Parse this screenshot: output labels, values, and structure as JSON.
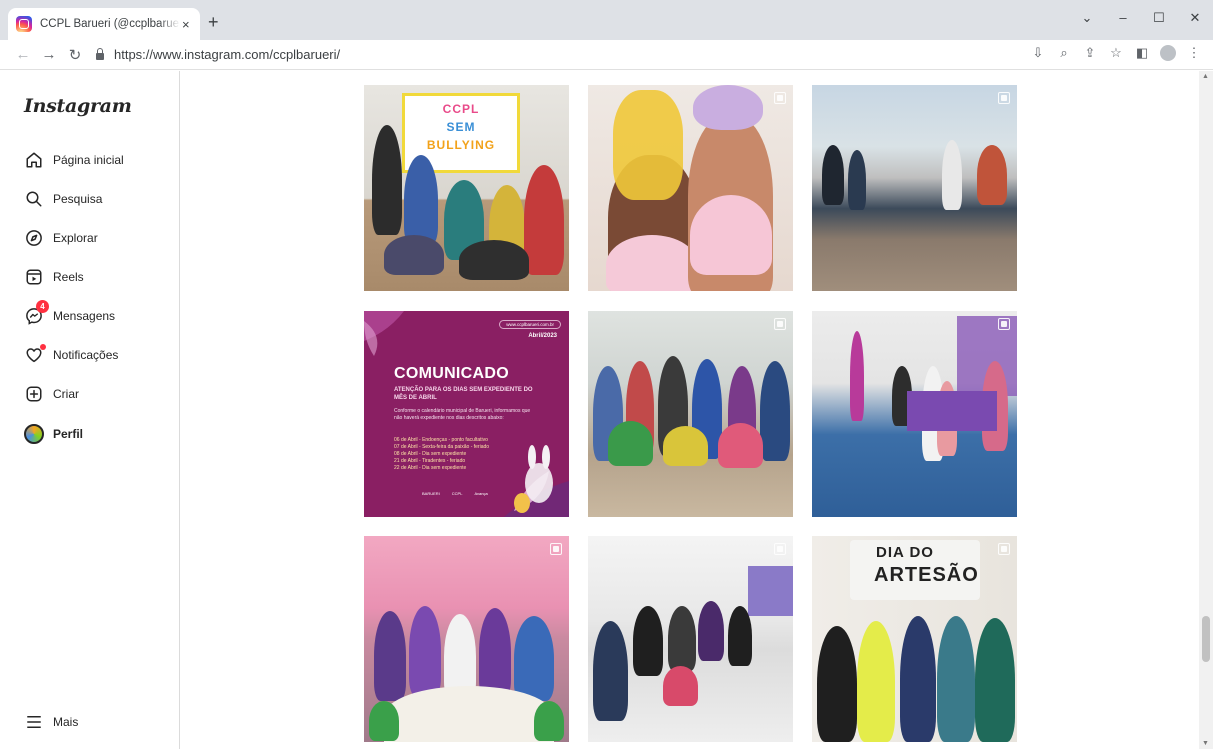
{
  "browser": {
    "tab_title": "CCPL Barueri (@ccplbarueri) • Fo",
    "tab_close": "×",
    "new_tab": "+",
    "url": "https://www.instagram.com/ccplbarueri/",
    "win_minimize": "–",
    "win_restore": "☐",
    "win_close": "✕",
    "win_dropdown": "⌄"
  },
  "sidebar": {
    "logo": "Instagram",
    "items": [
      {
        "label": "Página inicial",
        "icon": "home-icon"
      },
      {
        "label": "Pesquisa",
        "icon": "search-icon"
      },
      {
        "label": "Explorar",
        "icon": "compass-icon"
      },
      {
        "label": "Reels",
        "icon": "reels-icon"
      },
      {
        "label": "Mensagens",
        "icon": "messenger-icon",
        "badge": "4"
      },
      {
        "label": "Notificações",
        "icon": "heart-icon"
      },
      {
        "label": "Criar",
        "icon": "plus-square-icon"
      },
      {
        "label": "Perfil",
        "icon": "avatar"
      }
    ],
    "more": "Mais"
  },
  "posts": {
    "ccpl_sign": [
      "CCPL",
      "SEM",
      "BULLYING"
    ],
    "comunicado": {
      "site": "www.ccplbarueri.com.br",
      "date": "Abril/2023",
      "title": "COMUNICADO",
      "subtitle": "ATENÇÃO PARA OS DIAS SEM EXPEDIENTE DO MÊS DE ABRIL",
      "body": "Conforme o calendário municipal de Barueri, informamos que não haverá expediente nos dias descritos abaixo:",
      "list": [
        "06 de Abril - Endoenças - ponto facultativo",
        "07 de Abril - Sexta-feira da paixão - feriado",
        "08 de Abril - Dia sem expediente",
        "21 de Abril - Tiradentes - feriado",
        "22 de Abril - Dia sem expediente"
      ],
      "footer": [
        "BARUERI",
        "CCPL",
        "Avança"
      ]
    },
    "dia_sign": [
      "DIA DO",
      "ARTESÃO"
    ]
  },
  "colors": {
    "comunicado_bg": "#8a1f63",
    "badge": "#ff3040"
  }
}
